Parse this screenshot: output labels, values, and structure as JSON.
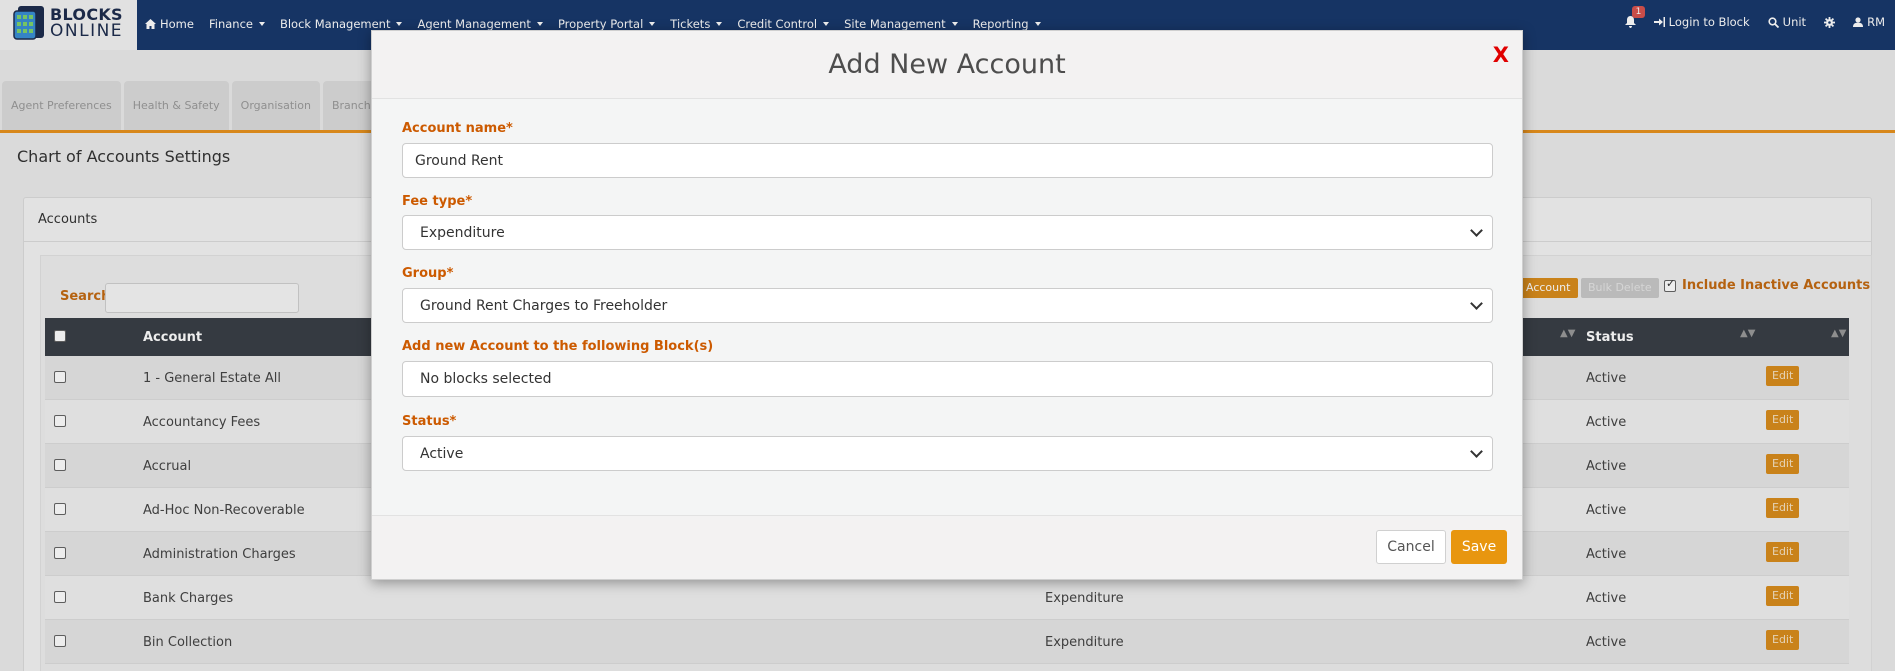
{
  "navbar": {
    "logo_line1": "BLOCKS",
    "logo_line2": "ONLINE",
    "items": [
      "Home",
      "Finance",
      "Block Management",
      "Agent Management",
      "Property Portal",
      "Tickets",
      "Credit Control",
      "Site Management",
      "Reporting"
    ],
    "notification_count": "1",
    "login_to_block": "Login to Block",
    "unit": "Unit",
    "user_initials": "RM"
  },
  "tabs": [
    "Agent Preferences",
    "Health & Safety",
    "Organisation",
    "Branch"
  ],
  "page": {
    "title": "Chart of Accounts Settings",
    "panel_title": "Accounts",
    "search_label": "Search",
    "add_account_label": "Account",
    "bulk_delete_label": "Bulk Delete",
    "include_inactive_label": "Include Inactive Accounts"
  },
  "table": {
    "headers": [
      "Account",
      "Status"
    ],
    "edit_label": "Edit",
    "rows": [
      {
        "account": "1 - General Estate All",
        "fee_type": "",
        "status": "Active"
      },
      {
        "account": "Accountancy Fees",
        "fee_type": "",
        "status": "Active"
      },
      {
        "account": "Accrual",
        "fee_type": "",
        "status": "Active"
      },
      {
        "account": "Ad-Hoc Non-Recoverable",
        "fee_type": "",
        "status": "Active"
      },
      {
        "account": "Administration Charges",
        "fee_type": "",
        "status": "Active"
      },
      {
        "account": "Bank Charges",
        "fee_type": "Expenditure",
        "status": "Active"
      },
      {
        "account": "Bin Collection",
        "fee_type": "Expenditure",
        "status": "Active"
      }
    ]
  },
  "modal": {
    "title": "Add New Account",
    "close": "X",
    "account_name_label": "Account name*",
    "account_name_value": "Ground Rent",
    "fee_type_label": "Fee type*",
    "fee_type_value": "Expenditure",
    "group_label": "Group*",
    "group_value": "Ground Rent Charges to Freeholder",
    "blocks_label": "Add new Account to the following Block(s)",
    "blocks_value": "No blocks selected",
    "status_label": "Status*",
    "status_value": "Active",
    "cancel": "Cancel",
    "save": "Save"
  },
  "colors": {
    "navbar": "#18386c",
    "accent": "#e8960f",
    "label": "#cc5a00",
    "close": "#e00000"
  }
}
